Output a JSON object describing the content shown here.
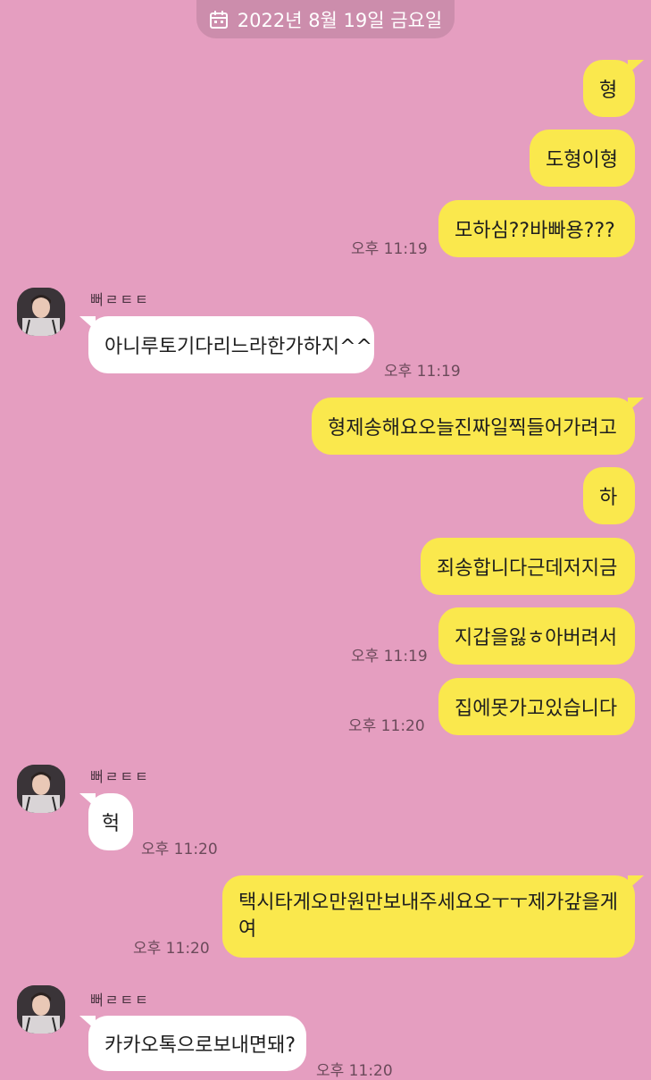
{
  "colors": {
    "background": "#e59ec0",
    "outgoing_bubble": "#fae84d",
    "incoming_bubble": "#ffffff"
  },
  "date_divider": {
    "icon": "calendar-icon",
    "text": "2022년 8월 19일 금요일"
  },
  "contact": {
    "name": "뻐ㄹㅌㅌ",
    "avatar": "avatar-photo"
  },
  "messages": [
    {
      "side": "out",
      "text": "형"
    },
    {
      "side": "out",
      "text": "도형이형"
    },
    {
      "side": "out",
      "text": "모하심??바빠용???",
      "time": "오후 11:19"
    },
    {
      "side": "in",
      "text": "아니루토기다리느라한가하지^^",
      "time": "오후 11:19"
    },
    {
      "side": "out",
      "text": "형제송해요오늘진짜일찍들어가려고"
    },
    {
      "side": "out",
      "text": "하"
    },
    {
      "side": "out",
      "text": "죄송합니다근데저지금"
    },
    {
      "side": "out",
      "text": "지갑을잃ㅎ아버려서",
      "time": "오후 11:19"
    },
    {
      "side": "out",
      "text": "집에못가고있습니다",
      "time": "오후 11:20"
    },
    {
      "side": "in",
      "text": "헉",
      "time": "오후 11:20"
    },
    {
      "side": "out",
      "text_line1": "택시타게오만원만보내주세요오ㅜㅜ제가갚을게",
      "text_line2": "여",
      "time": "오후 11:20"
    },
    {
      "side": "in",
      "text": "카카오톡으로보내면돼?",
      "time": "오후 11:20"
    }
  ]
}
